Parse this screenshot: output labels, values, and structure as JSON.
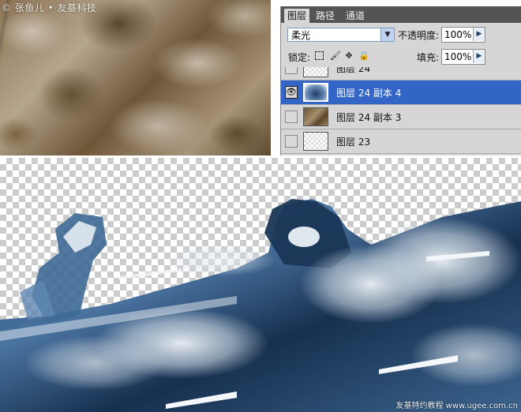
{
  "watermark_top": "© 张鱼儿 • 友基科技",
  "watermark_bottom": "友基特约教程 www.ugee.com.cn",
  "panel": {
    "tabs": [
      "图层",
      "路径",
      "通道"
    ],
    "active_tab": "图层",
    "blend_mode": "柔光",
    "opacity_label": "不透明度:",
    "opacity_value": "100%",
    "lock_label": "锁定:",
    "fill_label": "填充:",
    "fill_value": "100%",
    "layers": [
      {
        "name": "图层 24",
        "visible": false,
        "selected": false
      },
      {
        "name": "图层 24 副本 4",
        "visible": true,
        "selected": true
      },
      {
        "name": "图层 24 副本 3",
        "visible": false,
        "selected": false
      },
      {
        "name": "图层 23",
        "visible": false,
        "selected": false
      }
    ]
  },
  "colors": {
    "selection": "#3265c6",
    "panel_bg": "#d6d6d6",
    "tab_bar": "#545454"
  },
  "icons": {
    "eye": "eye-icon",
    "dropdown": "chevron-down-icon",
    "slider": "chevron-right-icon",
    "lock_transparency": "lock-transparency-icon",
    "lock_paint": "brush-icon",
    "lock_move": "move-icon",
    "lock_all": "lock-icon"
  }
}
